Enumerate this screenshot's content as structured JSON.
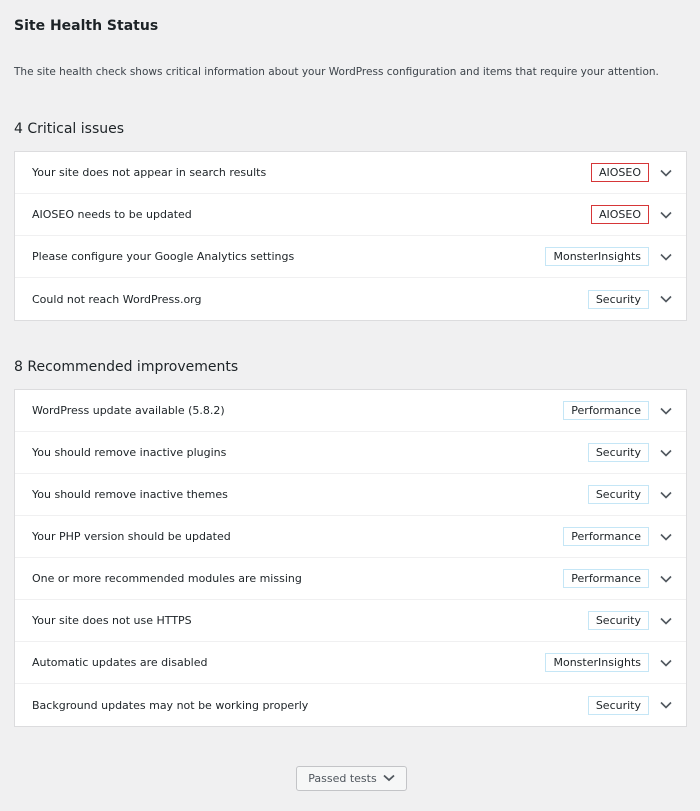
{
  "header": {
    "title": "Site Health Status",
    "description": "The site health check shows critical information about your WordPress configuration and items that require your attention."
  },
  "critical": {
    "heading": "4 Critical issues",
    "items": [
      {
        "label": "Your site does not appear in search results",
        "badge": "AIOSEO",
        "badge_style": "red"
      },
      {
        "label": "AIOSEO needs to be updated",
        "badge": "AIOSEO",
        "badge_style": "red"
      },
      {
        "label": "Please configure your Google Analytics settings",
        "badge": "MonsterInsights",
        "badge_style": "blue"
      },
      {
        "label": "Could not reach WordPress.org",
        "badge": "Security",
        "badge_style": "blue"
      }
    ]
  },
  "recommended": {
    "heading": "8 Recommended improvements",
    "items": [
      {
        "label": "WordPress update available (5.8.2)",
        "badge": "Performance",
        "badge_style": "blue"
      },
      {
        "label": "You should remove inactive plugins",
        "badge": "Security",
        "badge_style": "blue"
      },
      {
        "label": "You should remove inactive themes",
        "badge": "Security",
        "badge_style": "blue"
      },
      {
        "label": "Your PHP version should be updated",
        "badge": "Performance",
        "badge_style": "blue"
      },
      {
        "label": "One or more recommended modules are missing",
        "badge": "Performance",
        "badge_style": "blue"
      },
      {
        "label": "Your site does not use HTTPS",
        "badge": "Security",
        "badge_style": "blue"
      },
      {
        "label": "Automatic updates are disabled",
        "badge": "MonsterInsights",
        "badge_style": "blue"
      },
      {
        "label": "Background updates may not be working properly",
        "badge": "Security",
        "badge_style": "blue"
      }
    ]
  },
  "passed_button": {
    "label": "Passed tests",
    "icon": "chevron-down-icon"
  },
  "colors": {
    "critical_badge_border": "#d63638",
    "category_badge_border": "#c5e6f6",
    "background": "#f0f0f1"
  }
}
